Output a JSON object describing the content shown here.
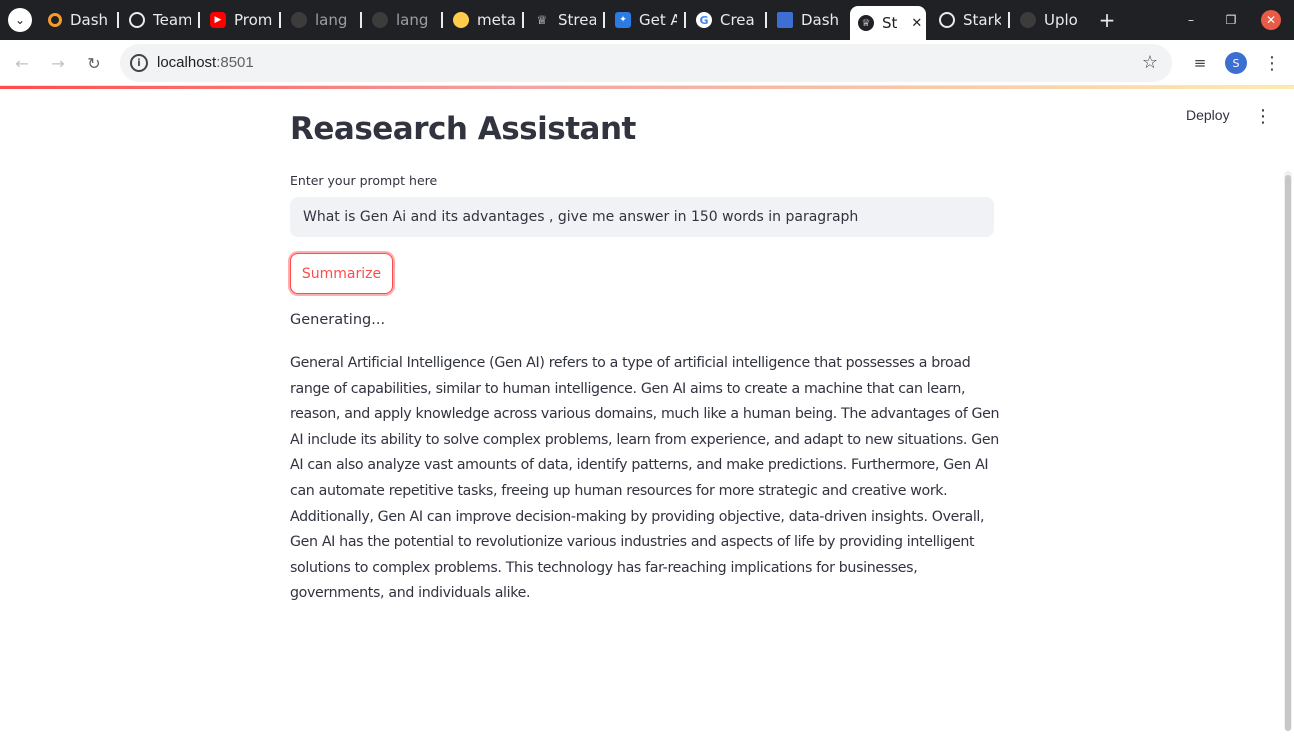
{
  "browser": {
    "tabs": [
      {
        "title": "Dash",
        "icon": "ring-icon",
        "color": "#f59b2a"
      },
      {
        "title": "Team",
        "icon": "chat-icon",
        "color": "#e8eaed"
      },
      {
        "title": "Prom",
        "icon": "youtube-icon",
        "color": "#ff0000"
      },
      {
        "title": "lang",
        "icon": "github-icon",
        "color": "#3c3c3c"
      },
      {
        "title": "lang",
        "icon": "github-icon",
        "color": "#3c3c3c"
      },
      {
        "title": "meta",
        "icon": "huggingface-icon",
        "color": "#ffcc4d"
      },
      {
        "title": "Strea",
        "icon": "streamlit-icon",
        "color": "#ffffff"
      },
      {
        "title": "Get A",
        "icon": "butterfly-icon",
        "color": "#2a7be4"
      },
      {
        "title": "Crea",
        "icon": "google-icon",
        "color": "#ffffff"
      },
      {
        "title": "Dash",
        "icon": "dashboard-icon",
        "color": "#3c6fd1"
      },
      {
        "title": "St",
        "icon": "streamlit-icon",
        "color": "#202124"
      },
      {
        "title": "Stark",
        "icon": "openai-icon",
        "color": "#e8eaed"
      },
      {
        "title": "Uplo",
        "icon": "github-icon",
        "color": "#3c3c3c"
      }
    ],
    "url_host": "localhost",
    "url_port": ":8501",
    "avatar_initial": "S"
  },
  "app": {
    "deploy_label": "Deploy",
    "title": "Reasearch Assistant",
    "prompt_label": "Enter your prompt here",
    "prompt_value": "What is Gen Ai and its advantages , give me answer in 150 words in paragraph",
    "summarize_label": "Summarize",
    "status_text": "Generating...",
    "answer_text": "General Artificial Intelligence (Gen AI) refers to a type of artificial intelligence that possesses a broad range of capabilities, similar to human intelligence. Gen AI aims to create a machine that can learn, reason, and apply knowledge across various domains, much like a human being. The advantages of Gen AI include its ability to solve complex problems, learn from experience, and adapt to new situations. Gen AI can also analyze vast amounts of data, identify patterns, and make predictions. Furthermore, Gen AI can automate repetitive tasks, freeing up human resources for more strategic and creative work. Additionally, Gen AI can improve decision-making by providing objective, data-driven insights. Overall, Gen AI has the potential to revolutionize various industries and aspects of life by providing intelligent solutions to complex problems. This technology has far-reaching implications for businesses, governments, and individuals alike."
  },
  "colors": {
    "accent": "#ff4b4b",
    "text": "#31333f",
    "input_bg": "#f0f2f6",
    "tabstrip_bg": "#202124"
  }
}
